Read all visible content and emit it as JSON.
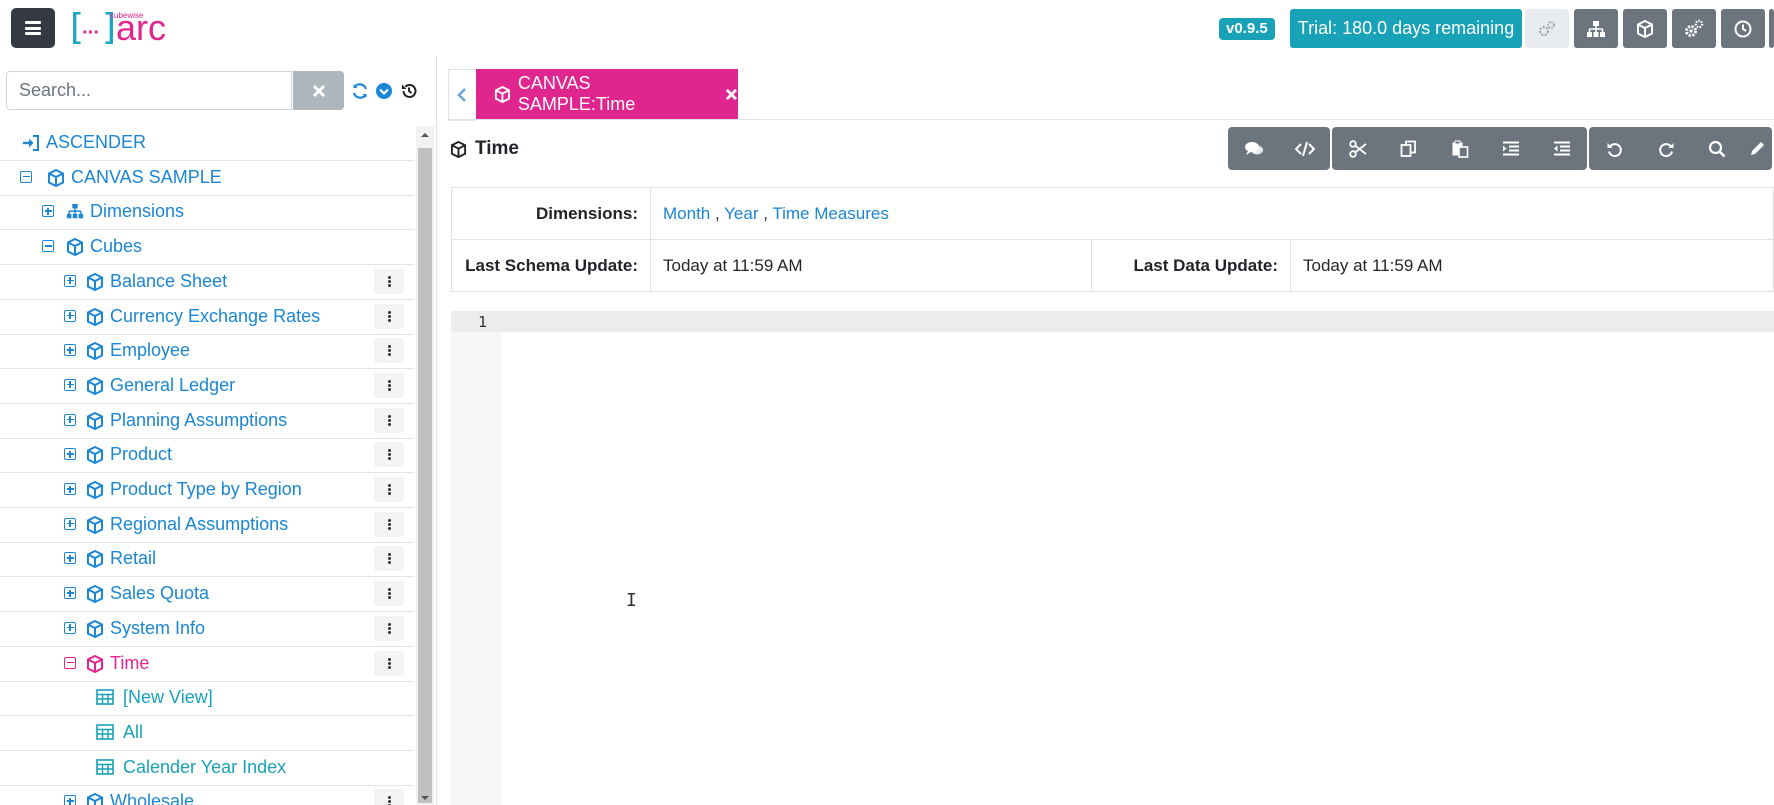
{
  "header": {
    "logo_prefix": "[...]",
    "logo_text": "arc",
    "logo_tagline": "cubewise",
    "version": "v0.9.5",
    "trial": "Trial: 180.0 days remaining",
    "icons": [
      "gears-icon",
      "sitemap-icon",
      "cube-icon",
      "cogs-icon",
      "clock-icon"
    ]
  },
  "sidebar": {
    "search_placeholder": "Search...",
    "tree": [
      {
        "label": "ASCENDER",
        "icon": "sign-in-icon",
        "level": 0
      },
      {
        "label": "CANVAS SAMPLE",
        "icon": "cube-icon",
        "level": 0,
        "expanded": true
      },
      {
        "label": "Dimensions",
        "icon": "sitemap-icon",
        "level": 1
      },
      {
        "label": "Cubes",
        "icon": "cube-icon",
        "level": 1,
        "expanded": true
      },
      {
        "label": "Balance Sheet",
        "icon": "cube-icon",
        "level": 2
      },
      {
        "label": "Currency Exchange Rates",
        "icon": "cube-icon",
        "level": 2
      },
      {
        "label": "Employee",
        "icon": "cube-icon",
        "level": 2
      },
      {
        "label": "General Ledger",
        "icon": "cube-icon",
        "level": 2
      },
      {
        "label": "Planning Assumptions",
        "icon": "cube-icon",
        "level": 2
      },
      {
        "label": "Product",
        "icon": "cube-icon",
        "level": 2
      },
      {
        "label": "Product Type by Region",
        "icon": "cube-icon",
        "level": 2
      },
      {
        "label": "Regional Assumptions",
        "icon": "cube-icon",
        "level": 2
      },
      {
        "label": "Retail",
        "icon": "cube-icon",
        "level": 2
      },
      {
        "label": "Sales Quota",
        "icon": "cube-icon",
        "level": 2
      },
      {
        "label": "System Info",
        "icon": "cube-icon",
        "level": 2
      },
      {
        "label": "Time",
        "icon": "cube-icon",
        "level": 2,
        "expanded": true,
        "active": true
      },
      {
        "label": "[New View]",
        "icon": "table-icon",
        "level": 3
      },
      {
        "label": "All",
        "icon": "table-icon",
        "level": 3
      },
      {
        "label": "Calender Year Index",
        "icon": "table-icon",
        "level": 3
      },
      {
        "label": "Wholesale",
        "icon": "cube-icon",
        "level": 2
      }
    ]
  },
  "main": {
    "tab_label": "CANVAS SAMPLE:Time",
    "title": "Time",
    "dimensions_label": "Dimensions:",
    "dimensions": [
      "Month",
      "Year",
      "Time Measures"
    ],
    "last_schema_label": "Last Schema Update:",
    "last_schema_value": "Today at 11:59 AM",
    "last_data_label": "Last Data Update:",
    "last_data_value": "Today at 11:59 AM",
    "editor_line": "1"
  },
  "colors": {
    "accent_pink": "#e1258f",
    "accent_teal": "#17a2b8",
    "link_blue": "#1b86d4",
    "dark": "#343a40",
    "toolbar_gray": "#6c757d"
  }
}
